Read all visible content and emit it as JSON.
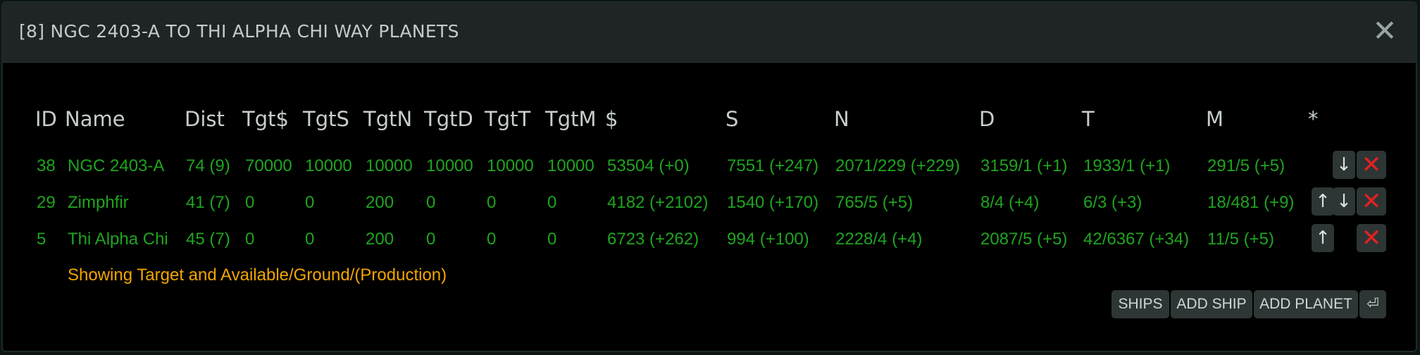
{
  "window": {
    "title": "[8] NGC 2403-A TO THI ALPHA CHI WAY PLANETS",
    "close_glyph": "✕"
  },
  "table": {
    "headers": [
      "ID",
      "Name",
      "Dist",
      "Tgt$",
      "TgtS",
      "TgtN",
      "TgtD",
      "TgtT",
      "TgtM",
      "$",
      "S",
      "N",
      "D",
      "T",
      "M",
      "*"
    ],
    "rows": [
      {
        "id": "38",
        "name": "NGC 2403-A",
        "dist": "74 (9)",
        "tgt_money": "70000",
        "tgt_s": "10000",
        "tgt_n": "10000",
        "tgt_d": "10000",
        "tgt_t": "10000",
        "tgt_m": "10000",
        "money": "53504 (+0)",
        "s": "7551 (+247)",
        "n": "2071/229 (+229)",
        "d": "3159/1 (+1)",
        "t": "1933/1 (+1)",
        "m": "291/5 (+5)"
      },
      {
        "id": "29",
        "name": "Zimphfir",
        "dist": "41 (7)",
        "tgt_money": "0",
        "tgt_s": "0",
        "tgt_n": "200",
        "tgt_d": "0",
        "tgt_t": "0",
        "tgt_m": "0",
        "money": "4182 (+2102)",
        "s": "1540 (+170)",
        "n": "765/5 (+5)",
        "d": "8/4 (+4)",
        "t": "6/3 (+3)",
        "m": "18/481 (+9)"
      },
      {
        "id": "5",
        "name": "Thi Alpha Chi",
        "dist": "45 (7)",
        "tgt_money": "0",
        "tgt_s": "0",
        "tgt_n": "200",
        "tgt_d": "0",
        "tgt_t": "0",
        "tgt_m": "0",
        "money": "6723 (+262)",
        "s": "994 (+100)",
        "n": "2228/4 (+4)",
        "d": "2087/5 (+5)",
        "t": "42/6367 (+34)",
        "m": "11/5 (+5)"
      }
    ],
    "note": "Showing Target and Available/Ground/(Production)"
  },
  "row_actions": {
    "up_glyph": "↑",
    "down_glyph": "↓",
    "remove_glyph": "✕"
  },
  "buttons": {
    "ships": "SHIPS",
    "add_ship": "ADD SHIP",
    "add_planet": "ADD PLANET",
    "return_glyph": "⏎"
  },
  "colors": {
    "data_text": "#1fa41f",
    "note_text": "#f2a500",
    "remove_icon": "#e52121"
  }
}
